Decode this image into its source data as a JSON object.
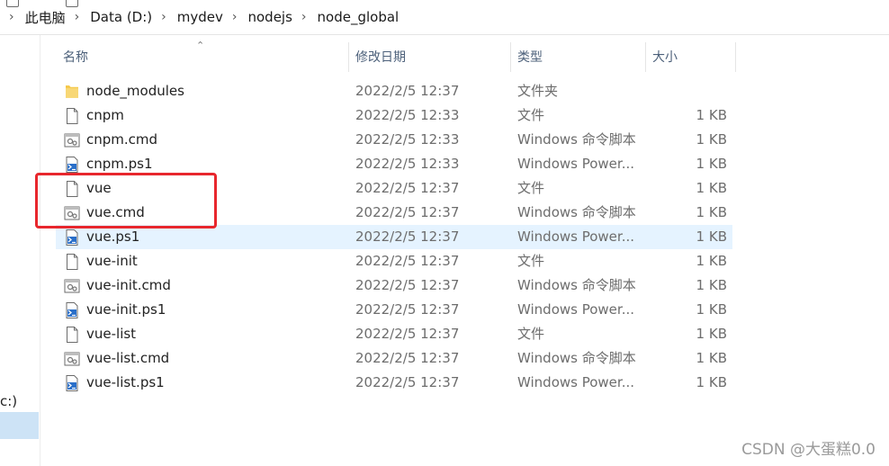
{
  "breadcrumb": [
    "此电脑",
    "Data (D:)",
    "mydev",
    "nodejs",
    "node_global"
  ],
  "columns": {
    "name": "名称",
    "date": "修改日期",
    "type": "类型",
    "size": "大小"
  },
  "nav": {
    "drive_label": "c:)"
  },
  "files": [
    {
      "icon": "folder-icon",
      "name": "node_modules",
      "date": "2022/2/5 12:37",
      "type": "文件夹",
      "size": ""
    },
    {
      "icon": "file-icon",
      "name": "cnpm",
      "date": "2022/2/5 12:33",
      "type": "文件",
      "size": "1 KB"
    },
    {
      "icon": "cmd-script-icon",
      "name": "cnpm.cmd",
      "date": "2022/2/5 12:33",
      "type": "Windows 命令脚本",
      "size": "1 KB"
    },
    {
      "icon": "powershell-script-icon",
      "name": "cnpm.ps1",
      "date": "2022/2/5 12:33",
      "type": "Windows Power...",
      "size": "1 KB"
    },
    {
      "icon": "file-icon",
      "name": "vue",
      "date": "2022/2/5 12:37",
      "type": "文件",
      "size": "1 KB"
    },
    {
      "icon": "cmd-script-icon",
      "name": "vue.cmd",
      "date": "2022/2/5 12:37",
      "type": "Windows 命令脚本",
      "size": "1 KB"
    },
    {
      "icon": "powershell-script-icon",
      "name": "vue.ps1",
      "date": "2022/2/5 12:37",
      "type": "Windows Power...",
      "size": "1 KB"
    },
    {
      "icon": "file-icon",
      "name": "vue-init",
      "date": "2022/2/5 12:37",
      "type": "文件",
      "size": "1 KB"
    },
    {
      "icon": "cmd-script-icon",
      "name": "vue-init.cmd",
      "date": "2022/2/5 12:37",
      "type": "Windows 命令脚本",
      "size": "1 KB"
    },
    {
      "icon": "powershell-script-icon",
      "name": "vue-init.ps1",
      "date": "2022/2/5 12:37",
      "type": "Windows Power...",
      "size": "1 KB"
    },
    {
      "icon": "file-icon",
      "name": "vue-list",
      "date": "2022/2/5 12:37",
      "type": "文件",
      "size": "1 KB"
    },
    {
      "icon": "cmd-script-icon",
      "name": "vue-list.cmd",
      "date": "2022/2/5 12:37",
      "type": "Windows 命令脚本",
      "size": "1 KB"
    },
    {
      "icon": "powershell-script-icon",
      "name": "vue-list.ps1",
      "date": "2022/2/5 12:37",
      "type": "Windows Power...",
      "size": "1 KB"
    }
  ],
  "highlighted_row_name": "vue.ps1",
  "annotation": {
    "color": "#e8272d",
    "boxed_files": [
      "vue",
      "vue.cmd"
    ]
  },
  "watermark": "CSDN @大蛋糕0.0",
  "colors": {
    "header_text": "#4c607a",
    "hover_row": "#e5f3ff",
    "nav_selected": "#cde3f6"
  }
}
